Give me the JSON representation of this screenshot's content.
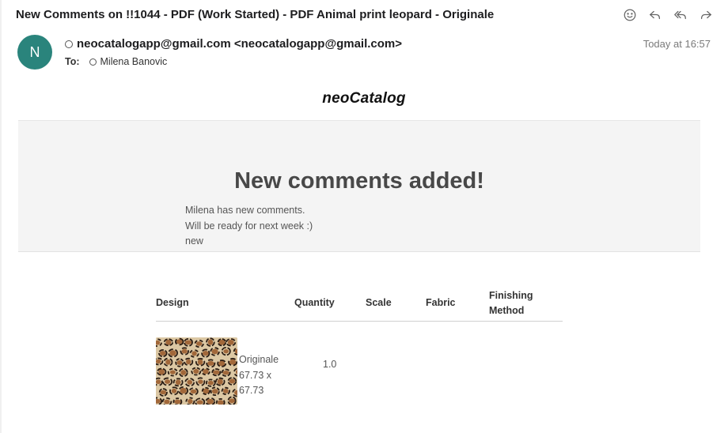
{
  "header": {
    "subject": "New Comments on !!1044 - PDF (Work Started) - PDF Animal print leopard - Originale",
    "avatar_initial": "N",
    "from": "neocatalogapp@gmail.com <neocatalogapp@gmail.com>",
    "to_label": "To:",
    "to": "Milena Banovic",
    "date": "Today at 16:57",
    "toolbar_icons": [
      "smiley-icon",
      "reply-icon",
      "reply-all-icon",
      "forward-icon"
    ]
  },
  "body": {
    "brand": "neoCatalog",
    "heading": "New comments added!",
    "message_lines": [
      "Milena has new comments.",
      "Will be ready for next week :)",
      "new"
    ],
    "table": {
      "headers": [
        "Design",
        "Quantity",
        "Scale",
        "Fabric",
        "Finishing Method"
      ],
      "finishing_lines": [
        "Finishing",
        "Method"
      ],
      "rows": [
        {
          "design_lines": [
            "Originale",
            "67.73 x",
            "67.73"
          ],
          "quantity": "1.0",
          "scale": "",
          "fabric": "",
          "finishing": ""
        }
      ]
    }
  },
  "colors": {
    "avatar": "#2a847c",
    "banner_bg": "#f4f4f4",
    "heading": "#484848"
  }
}
